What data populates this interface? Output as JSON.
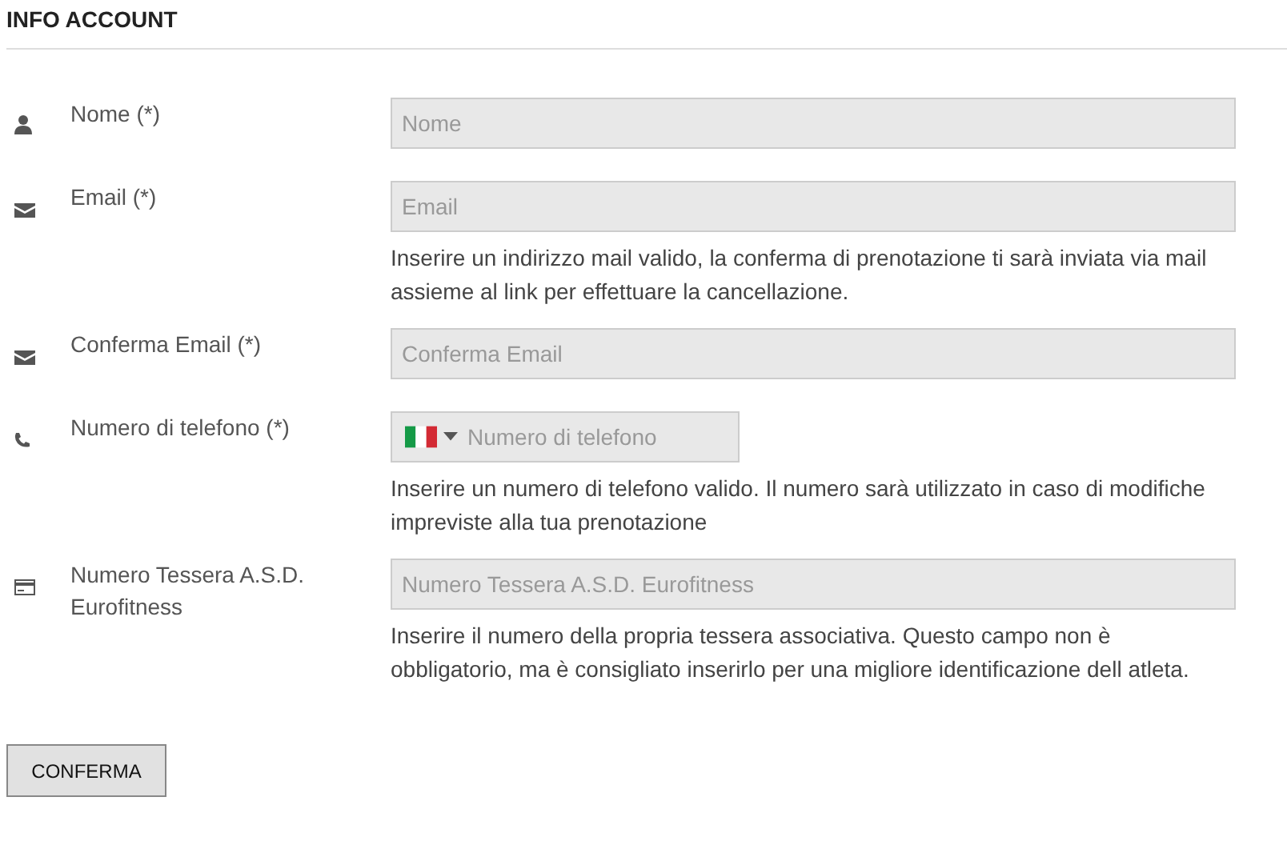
{
  "title": "INFO ACCOUNT",
  "fields": [
    {
      "kind": "name",
      "label": "Nome (*)",
      "placeholder": "Nome"
    },
    {
      "kind": "email",
      "label": "Email (*)",
      "placeholder": "Email",
      "help": "Inserire un indirizzo mail valido, la conferma di prenotazione ti sarà inviata via mail assieme al link per effettuare la cancellazione."
    },
    {
      "kind": "email",
      "label": "Conferma Email (*)",
      "placeholder": "Conferma Email"
    },
    {
      "kind": "phone",
      "label": "Numero di telefono (*)",
      "placeholder": "Numero di telefono",
      "help": "Inserire un numero di telefono valido. Il numero sarà utilizzato in caso di modifiche impreviste alla tua prenotazione"
    },
    {
      "kind": "card",
      "label": "Numero Tessera A.S.D. Eurofitness",
      "placeholder": "Numero Tessera A.S.D. Eurofitness",
      "help": "Inserire il numero della propria tessera associativa. Questo campo non è obbligatorio, ma è consigliato inserirlo per una migliore identificazione dell atleta."
    }
  ],
  "submit": "CONFERMA"
}
